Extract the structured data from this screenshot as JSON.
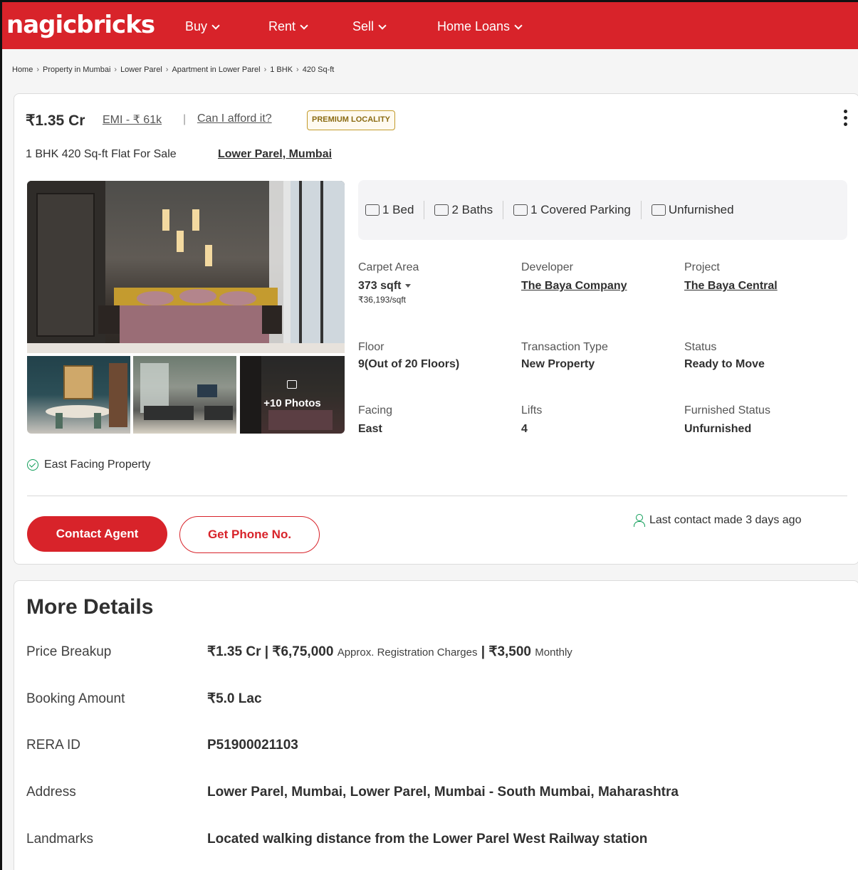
{
  "header": {
    "logo": "nagicbricks",
    "nav": [
      {
        "label": "Buy"
      },
      {
        "label": "Rent"
      },
      {
        "label": "Sell"
      },
      {
        "label": "Home Loans"
      }
    ],
    "brand_color": "#d8232a"
  },
  "breadcrumb": [
    "Home",
    "Property in Mumbai",
    "Lower Parel",
    "Apartment in Lower Parel",
    "1 BHK",
    "420 Sq-ft"
  ],
  "listing": {
    "price": "₹1.35 Cr",
    "emi": "EMI - ₹ 61k",
    "separator": "|",
    "afford": "Can I afford it?",
    "badge": "PREMIUM LOCALITY",
    "title": "1 BHK 420 Sq-ft Flat For Sale",
    "location": "Lower Parel, Mumbai",
    "more_photos": "+10 Photos",
    "features": [
      {
        "icon": "bed-icon",
        "label": "1 Bed"
      },
      {
        "icon": "bath-icon",
        "label": "2 Baths"
      },
      {
        "icon": "car-icon",
        "label": "1 Covered Parking"
      },
      {
        "icon": "furniture-icon",
        "label": "Unfurnished"
      }
    ],
    "attributes": {
      "carpet_area": {
        "label": "Carpet Area",
        "value": "373 sqft",
        "sub": "₹36,193/sqft"
      },
      "developer": {
        "label": "Developer",
        "value": "The Baya Company"
      },
      "project": {
        "label": "Project",
        "value": "The Baya Central"
      },
      "floor": {
        "label": "Floor",
        "value": "9(Out of 20 Floors)"
      },
      "transaction": {
        "label": "Transaction Type",
        "value": "New Property"
      },
      "status": {
        "label": "Status",
        "value": "Ready to Move"
      },
      "facing": {
        "label": "Facing",
        "value": "East"
      },
      "lifts": {
        "label": "Lifts",
        "value": "4"
      },
      "furnished": {
        "label": "Furnished Status",
        "value": "Unfurnished"
      }
    },
    "highlight": "East Facing Property",
    "contact_button": "Contact Agent",
    "phone_button": "Get Phone No.",
    "last_contact": "Last contact made 3 days ago"
  },
  "more_details": {
    "title": "More Details",
    "price_breakup": {
      "label": "Price Breakup",
      "price": "₹1.35 Cr",
      "pipe1": "|",
      "registration": "₹6,75,000",
      "registration_note": "Approx. Registration Charges",
      "pipe2": "|",
      "monthly": "₹3,500",
      "monthly_note": "Monthly"
    },
    "booking": {
      "label": "Booking Amount",
      "value": "₹5.0 Lac"
    },
    "rera": {
      "label": "RERA ID",
      "value": "P51900021103"
    },
    "address": {
      "label": "Address",
      "value": "Lower Parel, Mumbai, Lower Parel, Mumbai - South Mumbai, Maharashtra"
    },
    "landmarks": {
      "label": "Landmarks",
      "value": "Located walking distance from the Lower Parel West Railway station"
    }
  }
}
